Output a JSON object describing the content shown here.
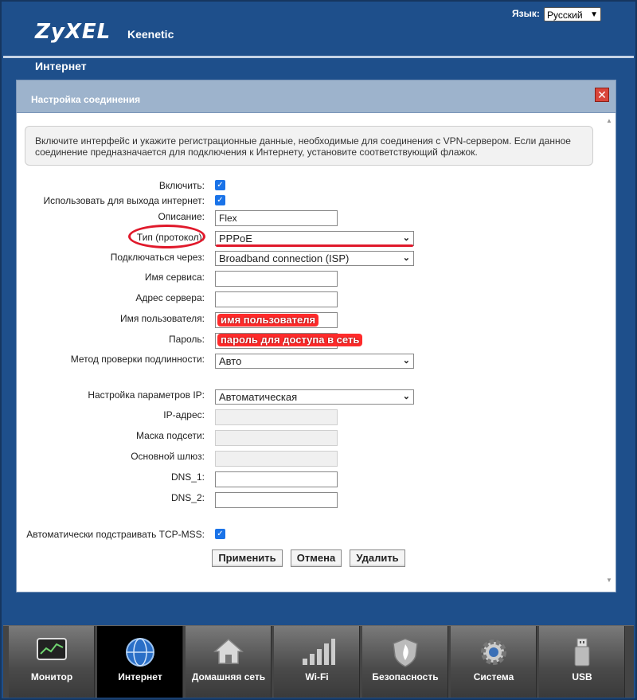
{
  "header": {
    "brand": "ZyXEL",
    "product": "Keenetic",
    "language_label": "Язык:",
    "language_value": "Русский",
    "section": "Интернет"
  },
  "dialog": {
    "title": "Настройка соединения",
    "notice": "Включите интерфейс и укажите регистрационные данные, необходимые для соединения с VPN-сервером. Если данное соединение предназначается для подключения к Интернету, установите соответствующий флажок.",
    "fields": {
      "enable_label": "Включить:",
      "enable_checked": true,
      "use_internet_label": "Использовать для выхода интернет:",
      "use_internet_checked": true,
      "description_label": "Описание:",
      "description_value": "Flex",
      "protocol_label": "Тип (протокол):",
      "protocol_value": "PPPoE",
      "connect_via_label": "Подключаться через:",
      "connect_via_value": "Broadband connection (ISP)",
      "service_name_label": "Имя сервиса:",
      "server_address_label": "Адрес сервера:",
      "username_label": "Имя пользователя:",
      "username_annotation": "имя пользователя",
      "password_label": "Пароль:",
      "password_annotation": "пароль для доступа в сеть",
      "auth_method_label": "Метод проверки подлинности:",
      "auth_method_value": "Авто",
      "ip_settings_label": "Настройка параметров IP:",
      "ip_settings_value": "Автоматическая",
      "ip_address_label": "IP-адрес:",
      "subnet_mask_label": "Маска подсети:",
      "gateway_label": "Основной шлюз:",
      "dns1_label": "DNS_1:",
      "dns2_label": "DNS_2:",
      "tcp_mss_label": "Автоматически подстраивать TCP-MSS:",
      "tcp_mss_checked": true
    },
    "buttons": {
      "apply": "Применить",
      "cancel": "Отмена",
      "delete": "Удалить"
    }
  },
  "taskbar": {
    "items": [
      {
        "label": "Монитор",
        "icon": "monitor-icon"
      },
      {
        "label": "Интернет",
        "icon": "globe-icon",
        "active": true
      },
      {
        "label": "Домашняя сеть",
        "icon": "house-icon"
      },
      {
        "label": "Wi-Fi",
        "icon": "signal-bars-icon"
      },
      {
        "label": "Безопасность",
        "icon": "shield-icon"
      },
      {
        "label": "Система",
        "icon": "gear-icon"
      },
      {
        "label": "USB",
        "icon": "usb-icon"
      }
    ]
  },
  "colors": {
    "background": "#1e4f8b",
    "dialog_header": "#9db3cc",
    "annotation_red": "#e0192b",
    "checkbox_blue": "#1a73e8"
  }
}
